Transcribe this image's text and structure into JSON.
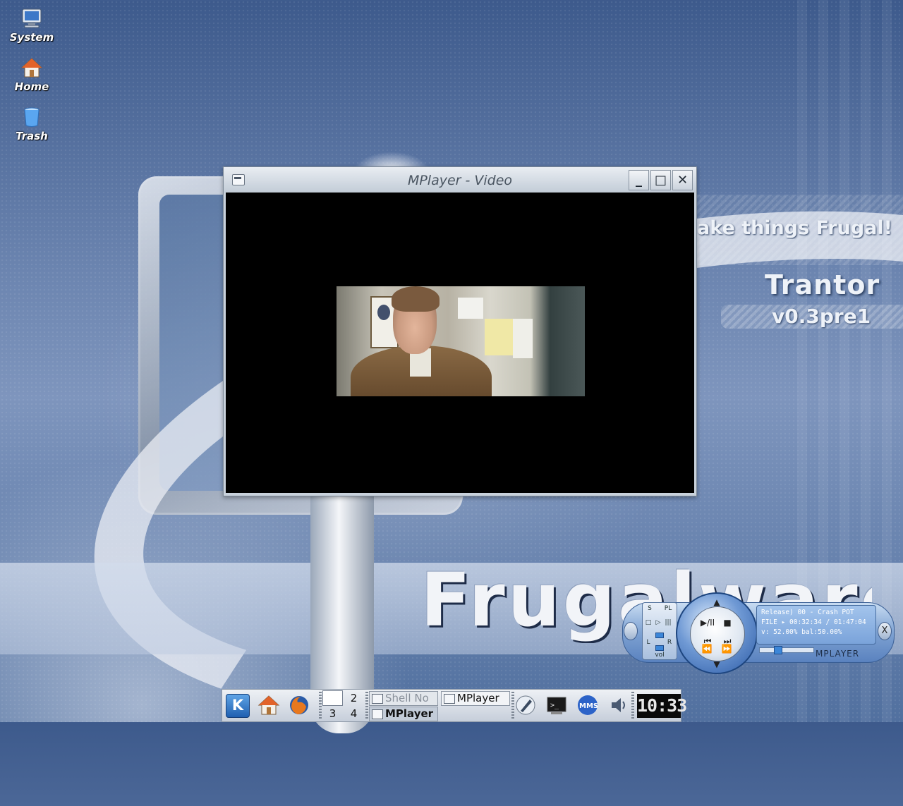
{
  "desktop": {
    "icons": [
      {
        "label": "System",
        "icon": "computer-icon"
      },
      {
        "label": "Home",
        "icon": "home-icon"
      },
      {
        "label": "Trash",
        "icon": "trash-icon"
      }
    ],
    "wallpaper": {
      "tagline": "ake things Frugal!",
      "codename": "Trantor",
      "version": "v0.3pre1",
      "brand": "Frugalware"
    }
  },
  "video_window": {
    "title": "MPlayer - Video",
    "buttons": {
      "minimize": "_",
      "maximize": "□",
      "close": "✕"
    }
  },
  "taskbar": {
    "pager": [
      "",
      "2",
      "3",
      "4"
    ],
    "tasks": [
      {
        "label": "Shell No",
        "state": "inactive"
      },
      {
        "label": "MPlayer",
        "state": "normal"
      },
      {
        "label": "MPlayer",
        "state": "active"
      }
    ],
    "clock": "10:33"
  },
  "mplayer_skin": {
    "title_line": "Release)  00 - Crash POT",
    "time_line": "FILE ▸ 00:32:34 / 01:47:04",
    "status_line": "v: 52.00%  bal:50.00%",
    "brand": "MPLAYER",
    "left_panel": {
      "s": "S",
      "pl": "PL",
      "l": "L",
      "r": "R",
      "vol": "vol"
    },
    "close_label": "X",
    "buttons": {
      "playpause": "▶/II",
      "stop": "■",
      "prev": "⏮",
      "next": "⏭",
      "rewind": "⏪",
      "forward": "⏩"
    },
    "volume": 0.52,
    "balance": 0.5,
    "progress": 0.305
  }
}
